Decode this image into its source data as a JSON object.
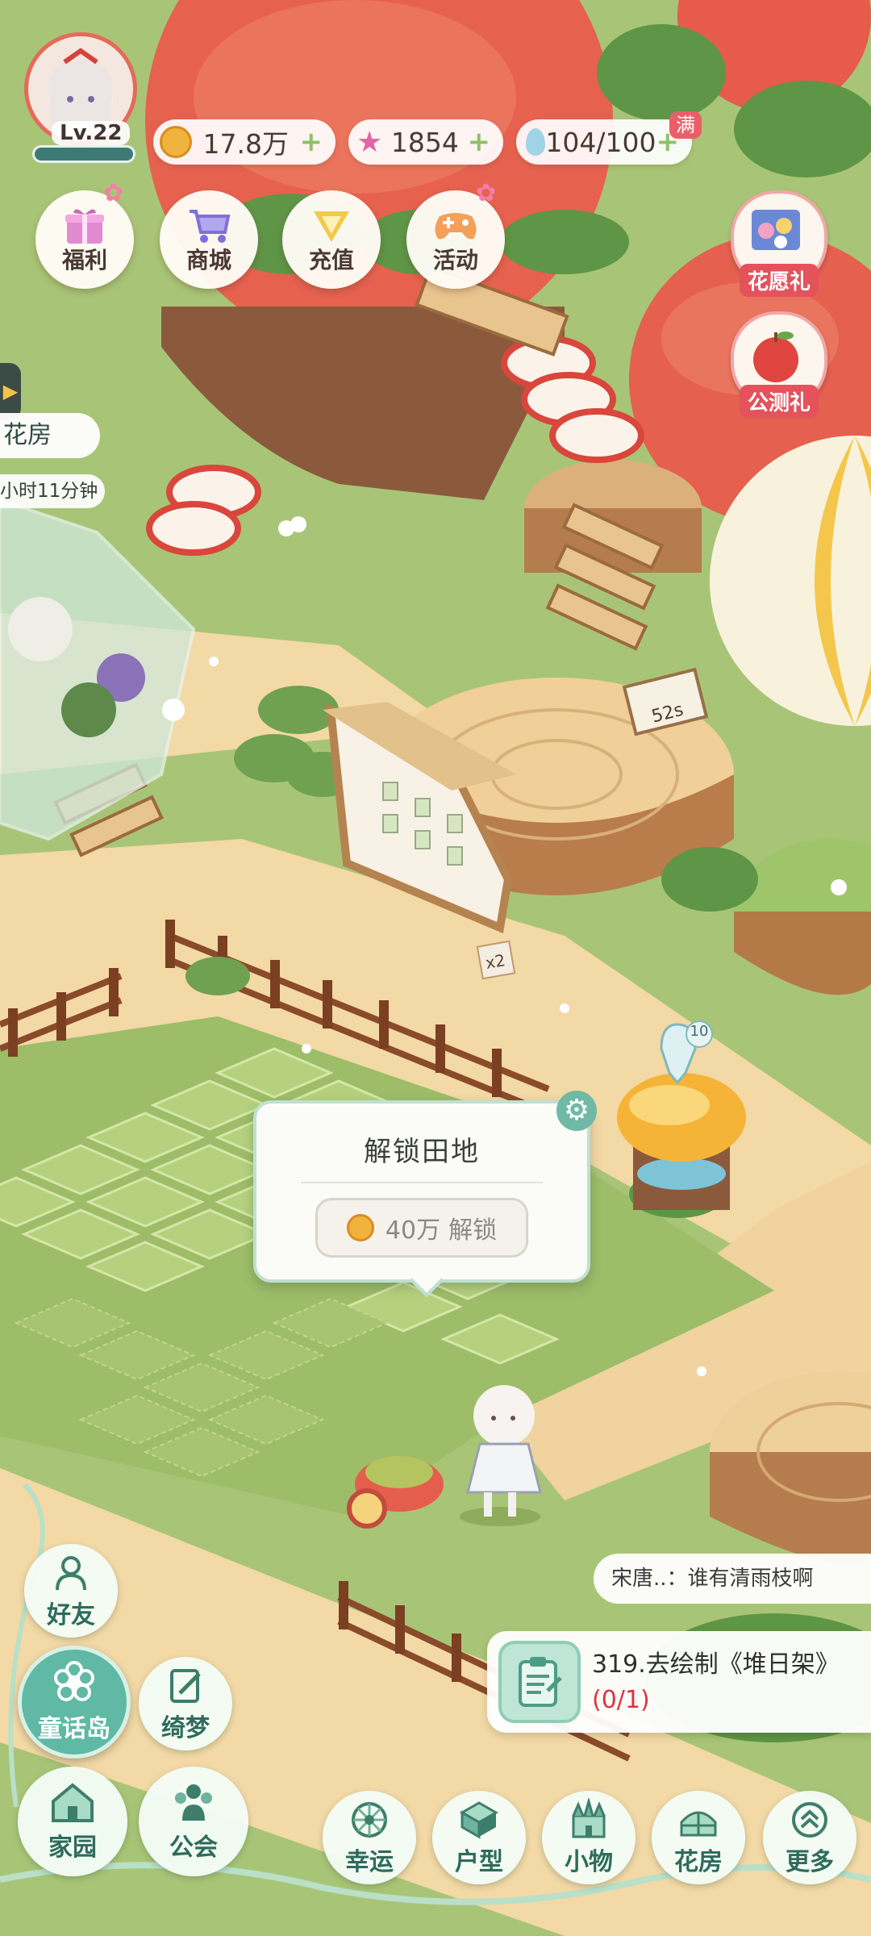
{
  "player": {
    "level": "Lv.22"
  },
  "currencies": {
    "coins": {
      "value": "17.8万",
      "icon": "coin-icon"
    },
    "stars": {
      "value": "1854",
      "icon": "star-icon"
    },
    "water": {
      "value": "104/100",
      "badge": "满",
      "icon": "water-drop-icon"
    }
  },
  "top_menu": [
    {
      "label": "福利",
      "icon": "gift-box-icon"
    },
    {
      "label": "商城",
      "icon": "shopping-cart-icon"
    },
    {
      "label": "充值",
      "icon": "diamond-v-icon"
    },
    {
      "label": "活动",
      "icon": "gamepad-icon"
    }
  ],
  "right_gifts": [
    {
      "label": "花愿礼",
      "icon": "flower-gift-icon"
    },
    {
      "label": "公测礼",
      "icon": "apple-gift-icon"
    }
  ],
  "left_side": {
    "building_label": "花房",
    "timer": "小时11分钟"
  },
  "scene_labels": {
    "sign_timer": "52s",
    "sign_count": "x2",
    "well_badge": "10"
  },
  "unlock_popup": {
    "title": "解锁田地",
    "cost": "40万",
    "action": "解锁"
  },
  "chat": {
    "text": "宋唐..：谁有清雨枝啊"
  },
  "quest": {
    "title": "319.去绘制《堆日架》",
    "progress": "(0/1)"
  },
  "left_buttons": [
    {
      "label": "好友",
      "icon": "friend-icon"
    },
    {
      "label": "童话岛",
      "icon": "flower-island-icon"
    },
    {
      "label": "绮梦",
      "icon": "dream-pen-icon"
    },
    {
      "label": "家园",
      "icon": "home-icon"
    },
    {
      "label": "公会",
      "icon": "guild-icon"
    }
  ],
  "bottom_bar": [
    {
      "label": "幸运",
      "icon": "lucky-wheel-icon"
    },
    {
      "label": "户型",
      "icon": "house-layout-icon"
    },
    {
      "label": "小物",
      "icon": "castle-icon"
    },
    {
      "label": "花房",
      "icon": "greenhouse-icon"
    },
    {
      "label": "更多",
      "icon": "chevron-up-icon"
    }
  ],
  "colors": {
    "accent_green": "#2e6b5c",
    "quest_red": "#e0333b",
    "coin_gold": "#e7a93a"
  }
}
